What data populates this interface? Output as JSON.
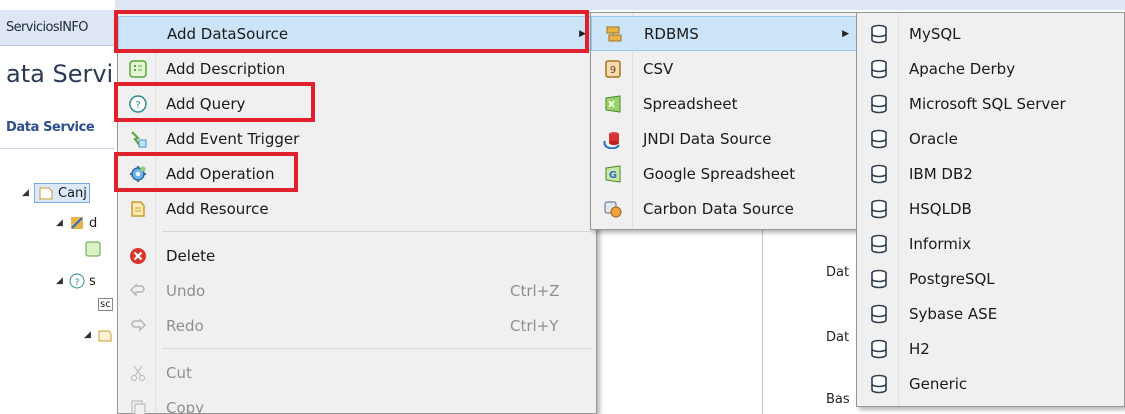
{
  "background": {
    "window_tab": "ServiciosINFO",
    "page_title": "ata Servi",
    "subtab": "Data Service",
    "tree": [
      {
        "label": "Canj"
      },
      {
        "label": "d"
      },
      {
        "label": "s"
      },
      {
        "label": "sc"
      }
    ],
    "form_labels": [
      "Dat",
      "Dat",
      "Bas"
    ]
  },
  "context_menu": {
    "items": [
      {
        "label": "Add DataSource",
        "icon": "blank-icon",
        "highlight": true,
        "submenu": true
      },
      {
        "label": "Add Description",
        "icon": "description-icon"
      },
      {
        "label": "Add Query",
        "icon": "query-icon"
      },
      {
        "label": "Add Event Trigger",
        "icon": "event-trigger-icon"
      },
      {
        "label": "Add Operation",
        "icon": "operation-gear-icon"
      },
      {
        "label": "Add Resource",
        "icon": "resource-icon"
      },
      {
        "label": "Delete",
        "icon": "delete-icon"
      },
      {
        "label": "Undo",
        "icon": "undo-icon",
        "shortcut": "Ctrl+Z",
        "disabled": true
      },
      {
        "label": "Redo",
        "icon": "redo-icon",
        "shortcut": "Ctrl+Y",
        "disabled": true
      },
      {
        "label": "Cut",
        "icon": "cut-icon",
        "disabled": true
      },
      {
        "label": "Copy",
        "icon": "copy-icon",
        "disabled": true
      }
    ]
  },
  "datasource_submenu": {
    "items": [
      {
        "label": "RDBMS",
        "icon": "rdbms-icon",
        "highlight": true,
        "submenu": true
      },
      {
        "label": "CSV",
        "icon": "csv-icon"
      },
      {
        "label": "Spreadsheet",
        "icon": "spreadsheet-icon"
      },
      {
        "label": "JNDI Data Source",
        "icon": "jndi-icon"
      },
      {
        "label": "Google Spreadsheet",
        "icon": "google-spreadsheet-icon"
      },
      {
        "label": "Carbon Data Source",
        "icon": "carbon-datasource-icon"
      }
    ]
  },
  "rdbms_submenu": {
    "items": [
      {
        "label": "MySQL"
      },
      {
        "label": "Apache Derby"
      },
      {
        "label": "Microsoft SQL Server"
      },
      {
        "label": "Oracle"
      },
      {
        "label": "IBM DB2"
      },
      {
        "label": "HSQLDB"
      },
      {
        "label": "Informix"
      },
      {
        "label": "PostgreSQL"
      },
      {
        "label": "Sybase ASE"
      },
      {
        "label": "H2"
      },
      {
        "label": "Generic"
      }
    ]
  },
  "colors": {
    "highlight_bg": "#cce4f7",
    "annotation_red": "#e0202a",
    "menu_bg": "#f0f0f0"
  }
}
